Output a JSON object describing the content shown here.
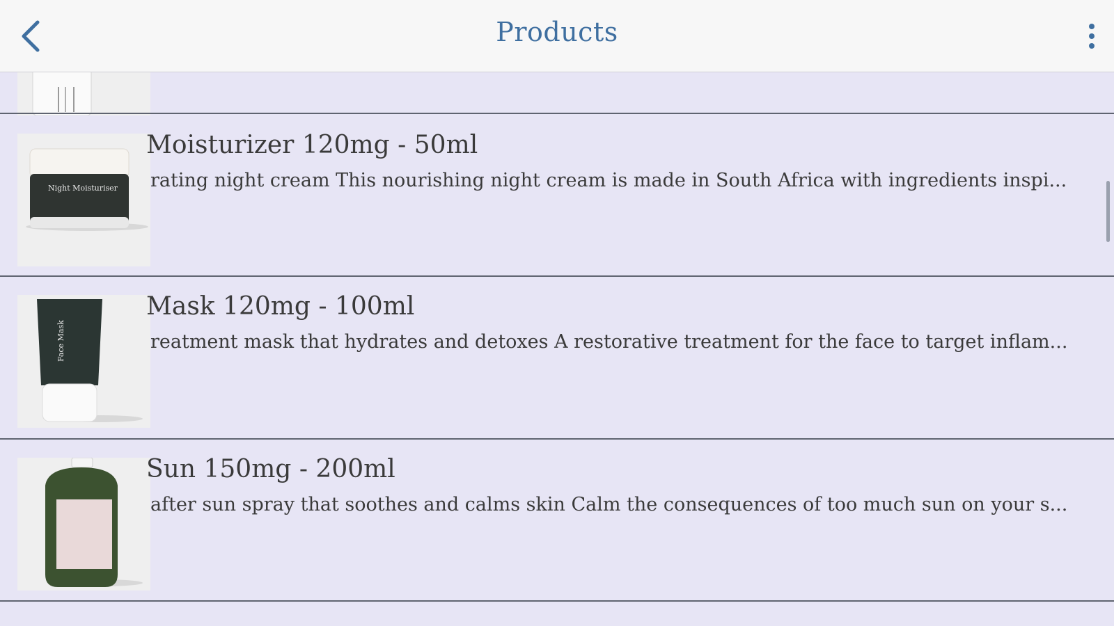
{
  "appbar": {
    "title": "Products",
    "back_icon": "chevron-left-icon",
    "menu_icon": "more-vertical-icon"
  },
  "colors": {
    "title_blue": "#3f6fa0",
    "list_background": "#e7e5f5",
    "divider": "#5f6470"
  },
  "products": [
    {
      "title": "",
      "description": ""
    },
    {
      "title": "Moisturizer 120mg - 50ml",
      "description": "rating night cream This nourishing night cream is made in South Africa with ingredients inspi...",
      "thumb_label": "Night Moisturiser"
    },
    {
      "title": "Mask 120mg - 100ml",
      "description": "reatment mask that hydrates and detoxes A restorative treatment for the face to target inflam...",
      "thumb_label": "Face Mask"
    },
    {
      "title": "Sun 150mg - 200ml",
      "description": "after sun spray that soothes and calms skin Calm the consequences of too much sun on your s..."
    }
  ]
}
